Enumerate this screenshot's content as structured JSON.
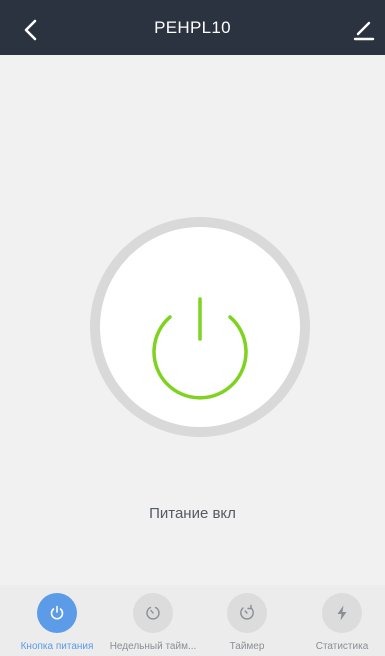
{
  "header": {
    "title": "PEHPL10",
    "back_icon": "chevron-left-icon",
    "edit_icon": "pencil-icon"
  },
  "device": {
    "status_text": "Питание вкл",
    "power_on": true,
    "power_color": "#7ed321"
  },
  "tabs": [
    {
      "label": "Кнопка питания",
      "icon": "power-icon",
      "active": true
    },
    {
      "label": "Недельный тайм...",
      "icon": "clock-icon",
      "active": false
    },
    {
      "label": "Таймер",
      "icon": "timer-icon",
      "active": false
    },
    {
      "label": "Статистика",
      "icon": "lightning-icon",
      "active": false
    }
  ],
  "colors": {
    "header_bg": "#2b3340",
    "accent": "#5b9be8",
    "background": "#f1f1f1"
  }
}
